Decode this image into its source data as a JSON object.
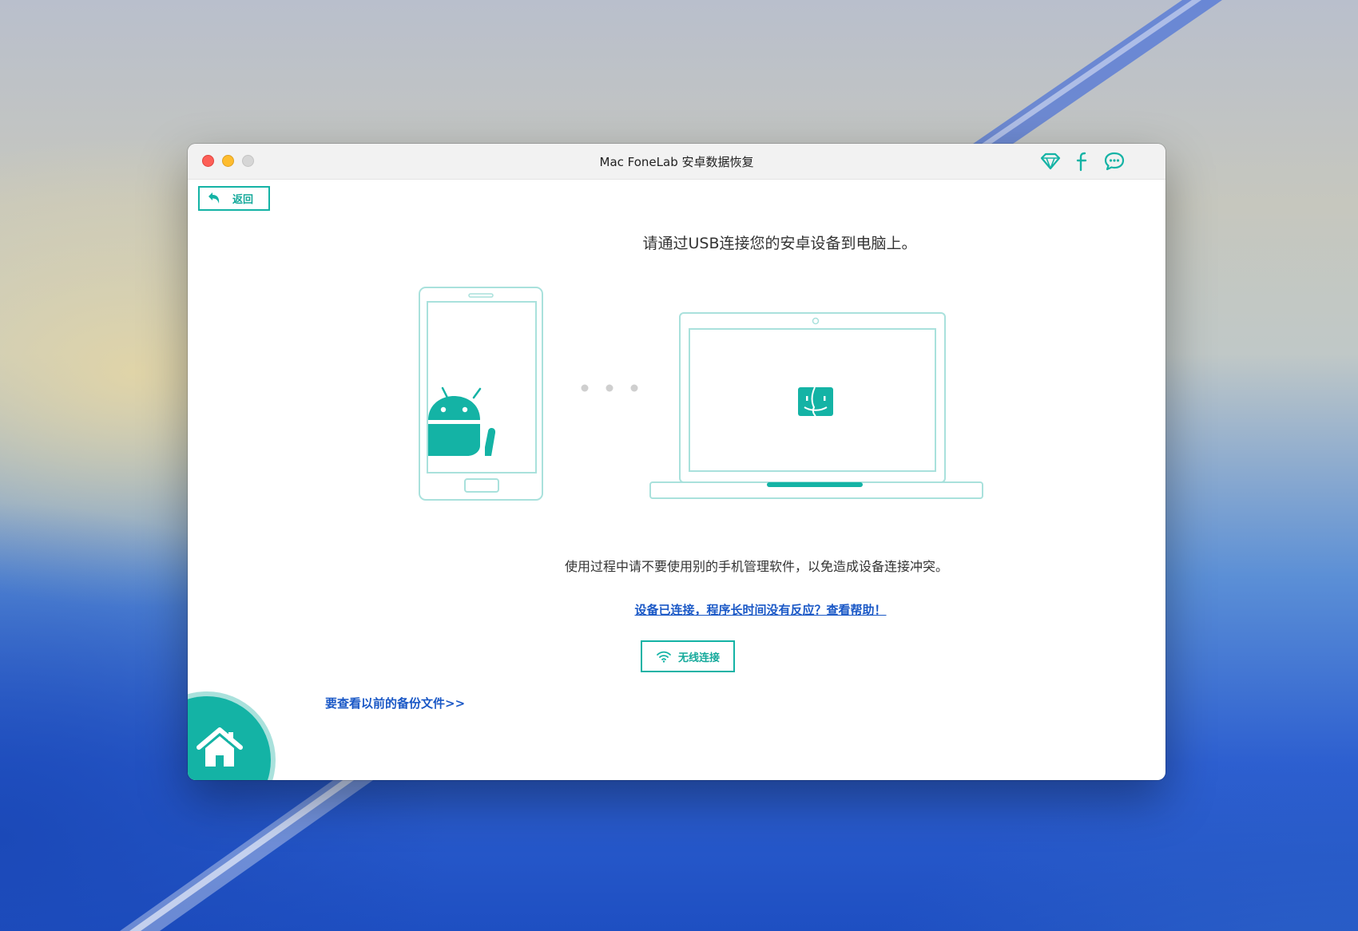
{
  "window": {
    "title": "Mac FoneLab 安卓数据恢复"
  },
  "titlebar_icons": [
    "diamond-icon",
    "facebook-icon",
    "chat-icon"
  ],
  "toolbar": {
    "back_label": "返回"
  },
  "main": {
    "headline": "请通过USB连接您的安卓设备到电脑上。",
    "note": "使用过程中请不要使用别的手机管理软件，以免造成设备连接冲突。",
    "help_link": "设备已连接，程序长时间没有反应？查看帮助！",
    "wireless_button": "无线连接",
    "backup_link": "要查看以前的备份文件>>"
  },
  "colors": {
    "accent": "#14b3a5",
    "link": "#1a58c6",
    "illustration_line": "#a9e1dc"
  }
}
